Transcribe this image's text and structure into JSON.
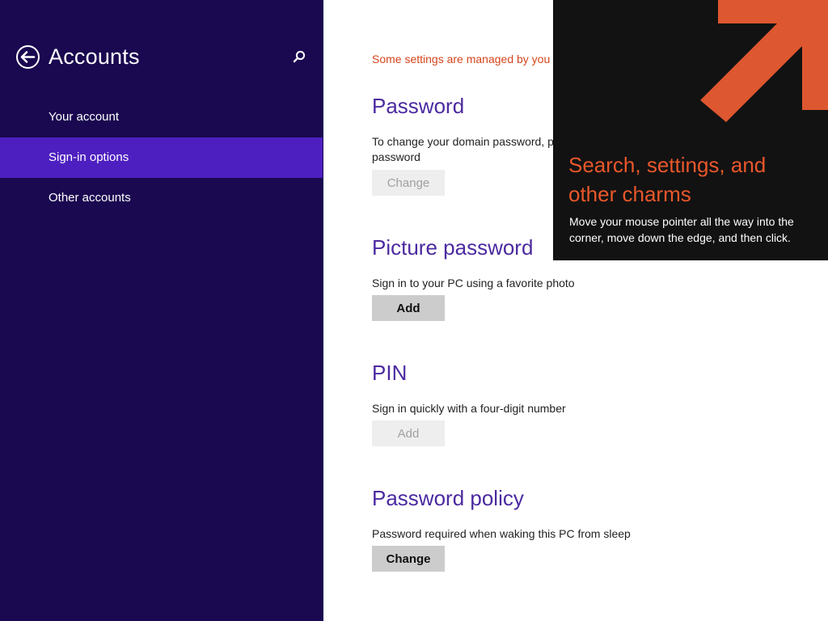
{
  "colors": {
    "nav_background": "#1a0850",
    "nav_selected": "#4e1fc0",
    "heading": "#4b2aa0",
    "warning": "#d4461d",
    "tip_background": "#121212",
    "tip_accent": "#e9572b"
  },
  "nav": {
    "title": "Accounts",
    "back_icon": "back-arrow-circle-icon",
    "search_icon": "search-icon",
    "items": [
      {
        "label": "Your account",
        "selected": false
      },
      {
        "label": "Sign-in options",
        "selected": true
      },
      {
        "label": "Other accounts",
        "selected": false
      }
    ]
  },
  "content": {
    "managed_note": "Some settings are managed by you",
    "sections": [
      {
        "title": "Password",
        "description": "To change your domain password, p",
        "description_line2": "password",
        "button": {
          "label": "Change",
          "enabled": false
        }
      },
      {
        "title": "Picture password",
        "description": "Sign in to your PC using a favorite photo",
        "button": {
          "label": "Add",
          "enabled": true
        }
      },
      {
        "title": "PIN",
        "description": "Sign in quickly with a four-digit number",
        "button": {
          "label": "Add",
          "enabled": false
        }
      },
      {
        "title": "Password policy",
        "description": "Password required when waking this PC from sleep",
        "button": {
          "label": "Change",
          "enabled": true
        }
      }
    ]
  },
  "charms_tip": {
    "title": "Search, settings, and other charms",
    "body": "Move your mouse pointer all the way into the corner, move down the edge, and then click.",
    "icon": "corner-arrow-icon"
  }
}
